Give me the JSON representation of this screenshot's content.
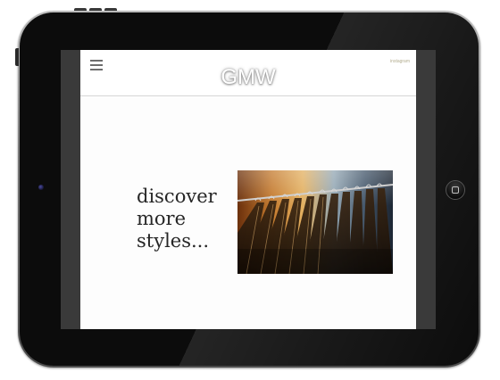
{
  "app": {
    "logo": "GMW",
    "social_link": "instagram"
  },
  "hero": {
    "tagline_lines": [
      "discover",
      "more",
      "styles..."
    ]
  },
  "icons": {
    "menu": "hamburger-menu-icon",
    "home": "home-button-icon",
    "camera": "front-camera-icon"
  },
  "colors": {
    "bezel": "#0c0c0c",
    "screen_background": "#fdfdfd",
    "tagline_text": "#262626",
    "social_link_text": "#b3ad8f",
    "header_divider": "#d6d6d6"
  }
}
